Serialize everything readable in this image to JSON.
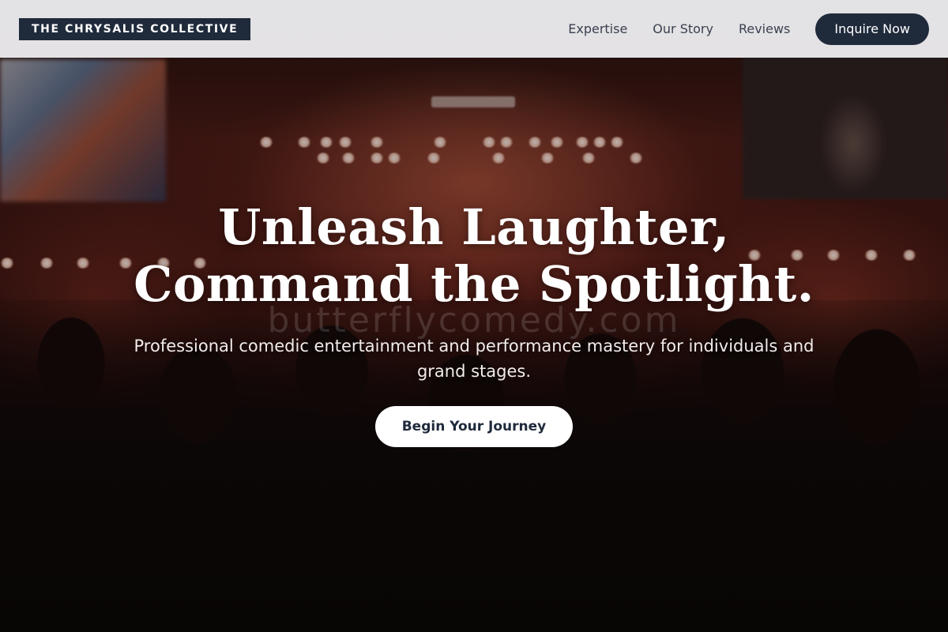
{
  "header": {
    "brand": "THE CHRYSALIS COLLECTIVE",
    "nav": [
      {
        "label": "Expertise"
      },
      {
        "label": "Our Story"
      },
      {
        "label": "Reviews"
      }
    ],
    "cta_label": "Inquire Now"
  },
  "hero": {
    "title_line1": "Unleash Laughter,",
    "title_line2": "Command the Spotlight.",
    "subtitle": "Professional comedic entertainment and performance mastery for individuals and grand stages.",
    "button_label": "Begin Your Journey",
    "watermark": "butterflycomedy.com"
  },
  "colors": {
    "brand_dark": "#1f2a3b",
    "header_bg": "#f0f0f2",
    "button_light": "#ffffff"
  }
}
